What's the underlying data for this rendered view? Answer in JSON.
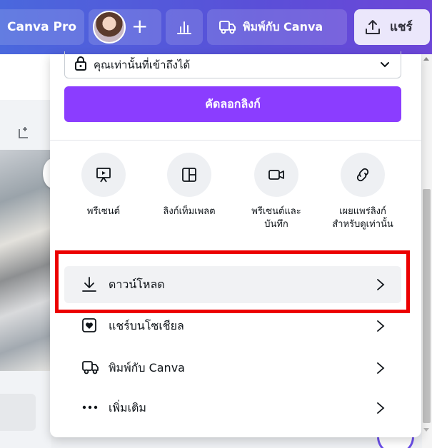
{
  "topbar": {
    "brand": "Canva Pro",
    "print_label": "พิมพ์กับ Canva",
    "share_label": "แชร์",
    "plus": "+"
  },
  "share_panel": {
    "access": {
      "label": "คุณเท่านั้นที่เข้าถึงได้"
    },
    "copy_link_label": "คัดลอกลิงก์",
    "quick_options": [
      {
        "label": "พรีเซนต์",
        "icon": "present-icon"
      },
      {
        "label": "ลิงก์เท็มเพลต",
        "icon": "template-icon"
      },
      {
        "label_line1": "พรีเซนต์และ",
        "label_line2": "บันทึก",
        "icon": "record-icon"
      },
      {
        "label_line1": "เผยแพร่ลิงก์",
        "label_line2": "สำหรับดูเท่านั้น",
        "icon": "link-icon"
      }
    ],
    "actions": [
      {
        "label": "ดาวน์โหลด",
        "icon": "download-icon"
      },
      {
        "label": "แชร์บนโซเชียล",
        "icon": "heart-icon"
      },
      {
        "label": "พิมพ์กับ Canva",
        "icon": "truck-icon"
      },
      {
        "label": "เพิ่มเติม",
        "icon": "more-icon"
      }
    ]
  },
  "colors": {
    "accent": "#8b3dff",
    "highlight": "#ec0000",
    "topbar_start": "#4a68dd",
    "topbar_end": "#6d46d8"
  }
}
